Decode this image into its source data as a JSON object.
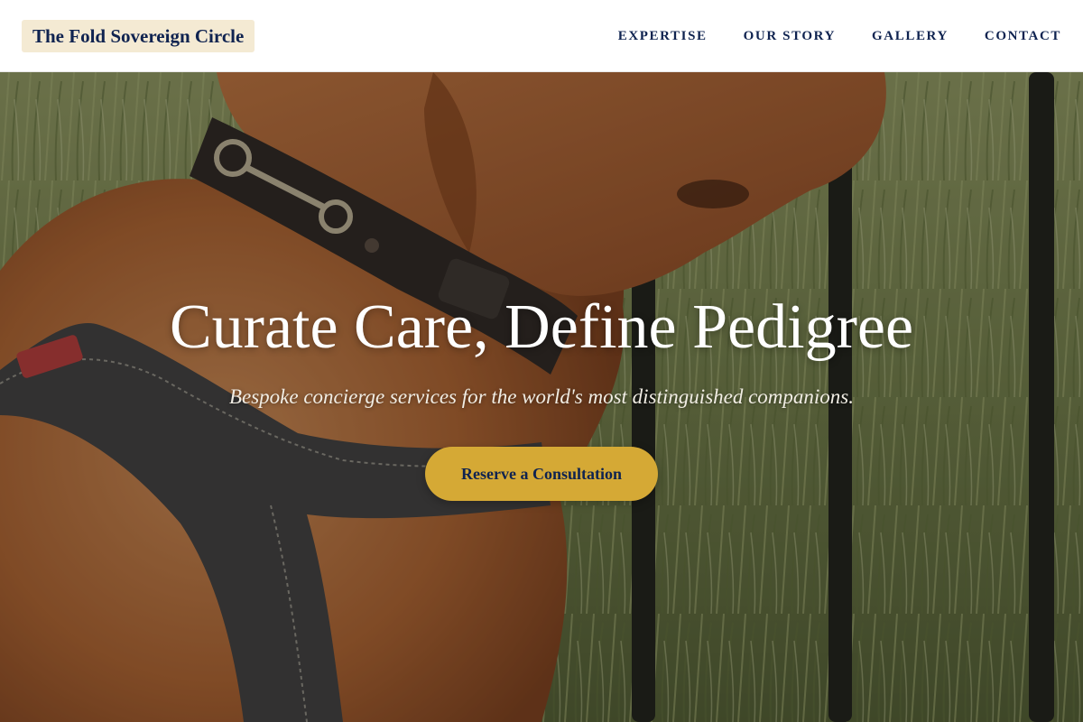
{
  "header": {
    "brand": "The Fold Sovereign Circle",
    "nav": [
      {
        "label": "EXPERTISE"
      },
      {
        "label": "OUR STORY"
      },
      {
        "label": "GALLERY"
      },
      {
        "label": "CONTACT"
      }
    ]
  },
  "hero": {
    "title": "Curate Care, Define Pedigree",
    "subtitle": "Bespoke concierge services for the world's most distinguished companions.",
    "cta_label": "Reserve a Consultation",
    "background_image": "dog-with-collar-and-harness-photo"
  },
  "colors": {
    "navy": "#0f2350",
    "gold": "#d5a935",
    "brand_bg": "#f4ead3",
    "header_bg": "#ffffff"
  }
}
